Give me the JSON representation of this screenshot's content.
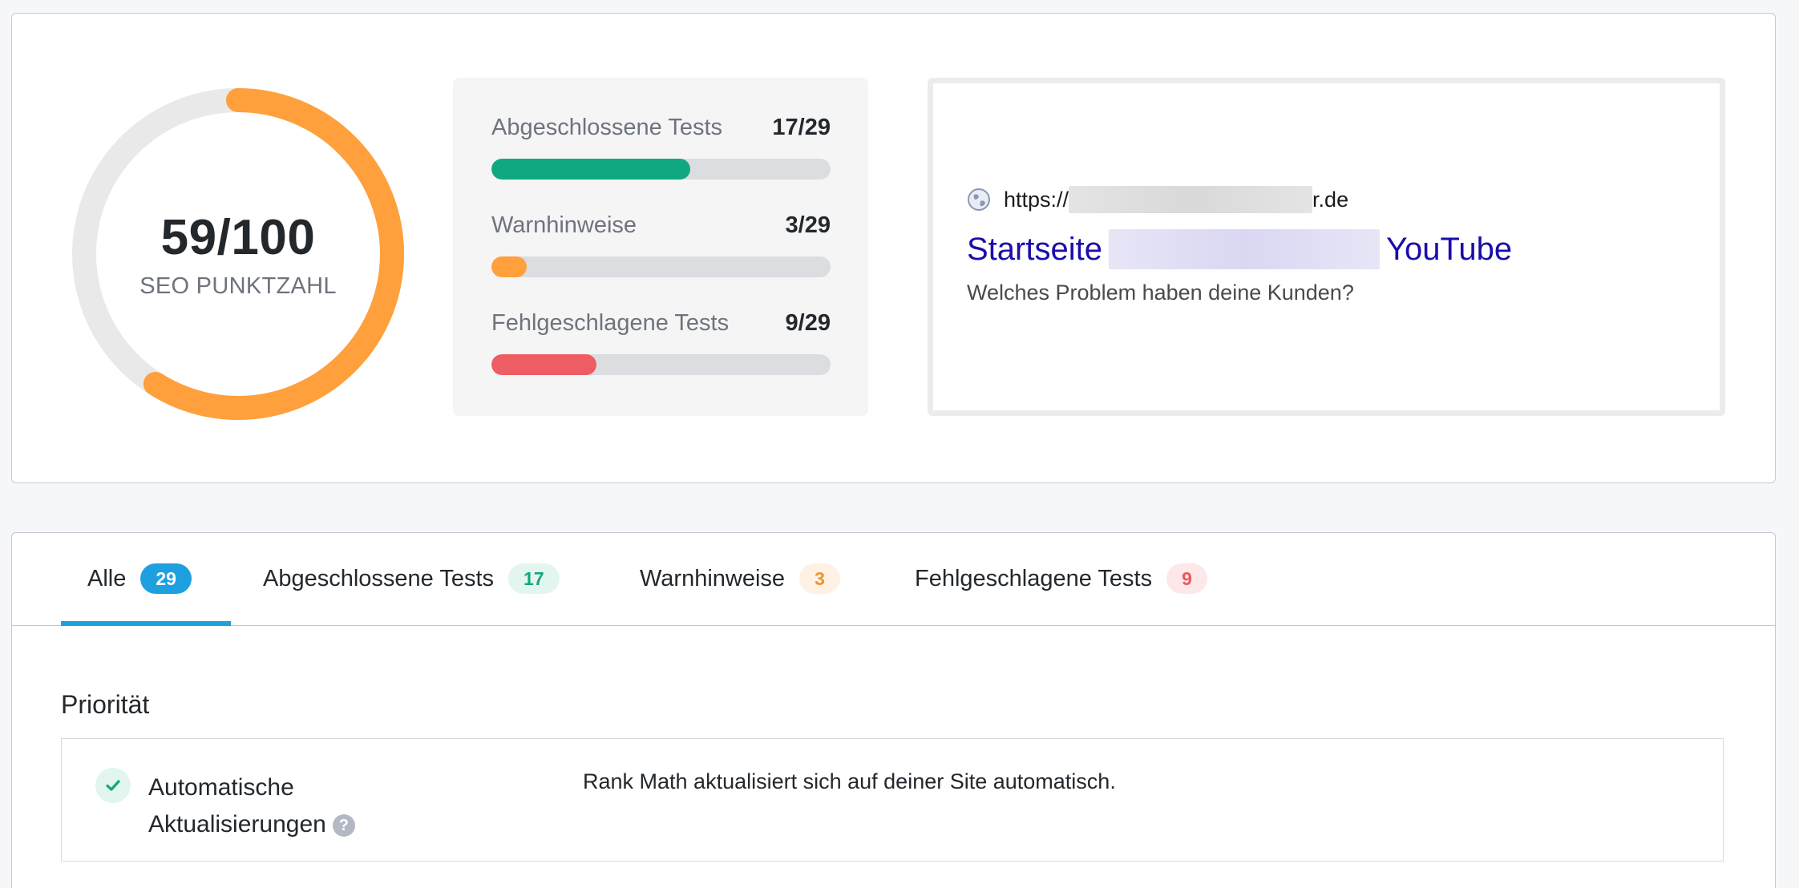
{
  "score": {
    "value": "59/100",
    "label": "SEO PUNKTZAHL",
    "fraction": 0.59,
    "ring_color": "#ffa03c",
    "track_color": "#e9e9e9"
  },
  "stats": [
    {
      "label": "Abgeschlossene Tests",
      "count": "17/29",
      "fraction": 0.586,
      "color": "#10a97f"
    },
    {
      "label": "Warnhinweise",
      "count": "3/29",
      "fraction": 0.103,
      "color": "#ffa03c"
    },
    {
      "label": "Fehlgeschlagene Tests",
      "count": "9/29",
      "fraction": 0.31,
      "color": "#ee5d63"
    }
  ],
  "serp": {
    "url_prefix": "https://",
    "url_suffix": "r.de",
    "title_start": "Startseite",
    "title_end": "YouTube",
    "description": "Welches Problem haben deine Kunden?",
    "icon": "globe-icon"
  },
  "tabs": [
    {
      "label": "Alle",
      "count": "29",
      "badge_bg": "#1e9fe0",
      "badge_fg": "#ffffff",
      "active": true
    },
    {
      "label": "Abgeschlossene Tests",
      "count": "17",
      "badge_bg": "#e2f5ee",
      "badge_fg": "#10a97f",
      "active": false
    },
    {
      "label": "Warnhinweise",
      "count": "3",
      "badge_bg": "#fff1e3",
      "badge_fg": "#f0922c",
      "active": false
    },
    {
      "label": "Fehlgeschlagene Tests",
      "count": "9",
      "badge_bg": "#fde8e9",
      "badge_fg": "#e8575d",
      "active": false
    }
  ],
  "section": {
    "title": "Priorität"
  },
  "check": {
    "title": "Automatische Aktualisierungen",
    "description": "Rank Math aktualisiert sich auf deiner Site automatisch.",
    "status_icon": "check-icon",
    "help_icon": "help-icon",
    "help_glyph": "?"
  }
}
